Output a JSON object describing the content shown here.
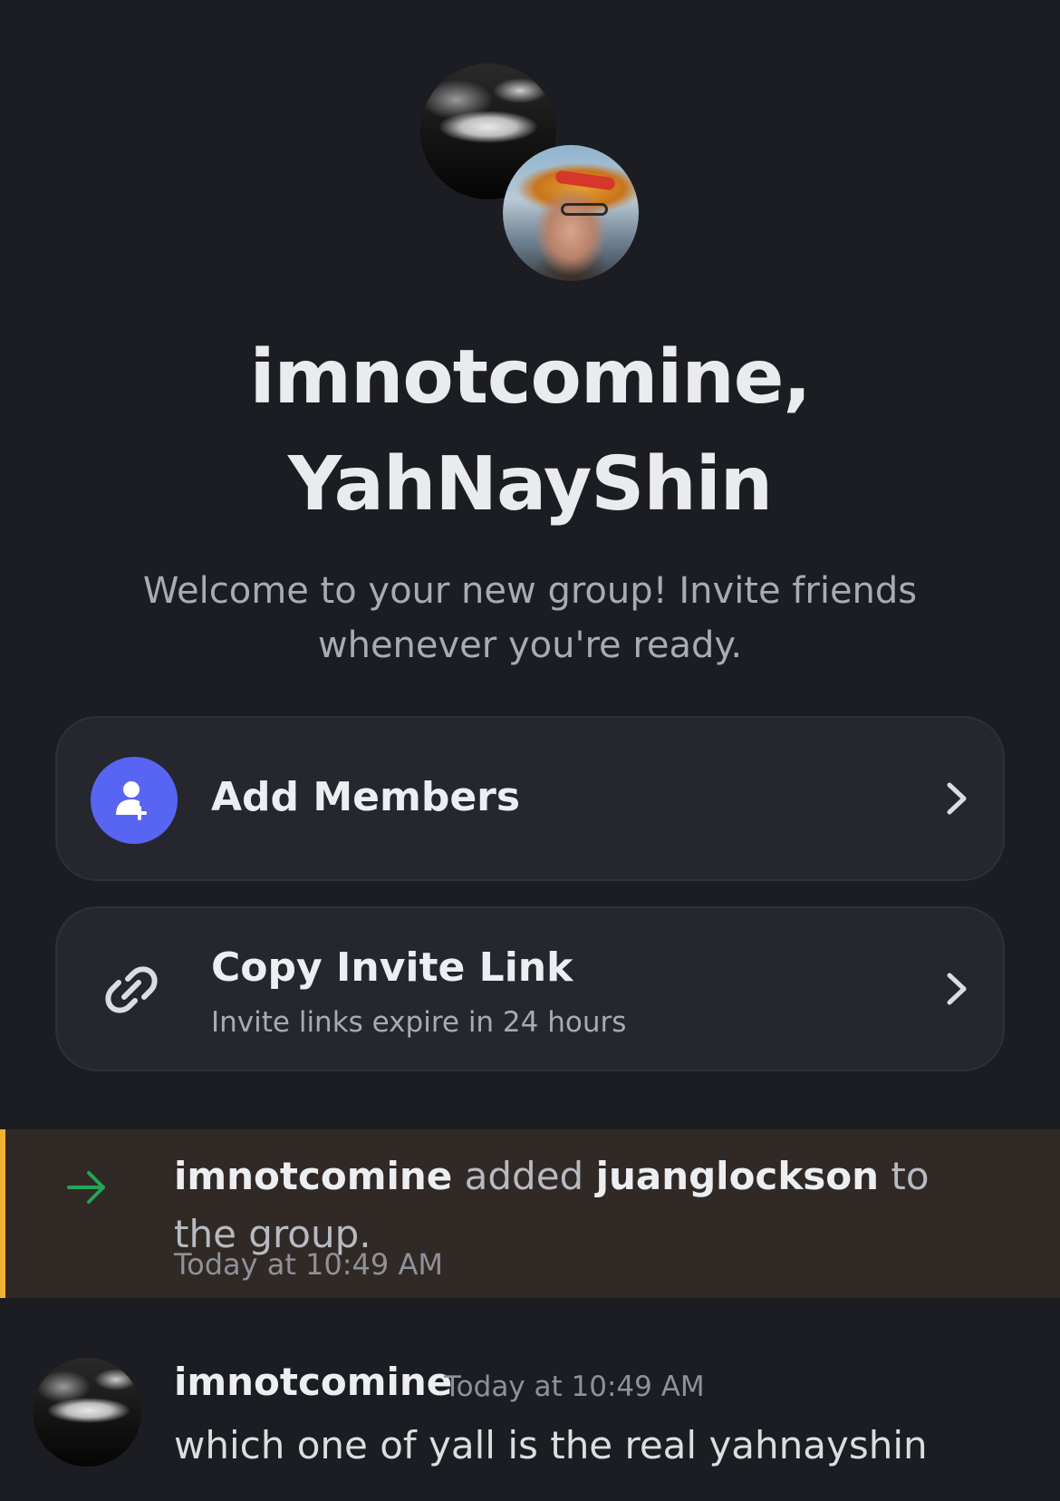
{
  "group": {
    "title_line1": "imnotcomine,",
    "title_line2": "YahNayShin",
    "welcome_text": "Welcome to your new group! Invite friends whenever you're ready."
  },
  "actions": {
    "add_members": {
      "label": "Add Members",
      "icon": "add-user-icon"
    },
    "copy_invite": {
      "label": "Copy Invite Link",
      "sublabel": "Invite links expire in 24 hours",
      "icon": "link-icon"
    }
  },
  "system_message": {
    "actor": "imnotcomine",
    "verb": "added",
    "target": "juanglockson",
    "suffix": "to the group.",
    "timestamp": "Today at 10:49 AM",
    "icon": "arrow-right-icon"
  },
  "messages": [
    {
      "author": "imnotcomine",
      "timestamp": "Today at 10:49 AM",
      "text": "which one of yall is the real yahnayshin"
    }
  ],
  "colors": {
    "background": "#1c1d22",
    "card": "#26272e",
    "blurple": "#5865f2",
    "system_highlight": "#302925",
    "system_accent": "#f0b232",
    "join_arrow": "#23a55a"
  }
}
